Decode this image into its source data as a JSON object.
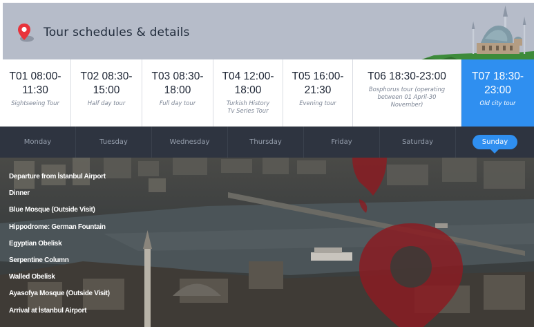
{
  "header": {
    "title": "Tour schedules & details",
    "icon": "map-pin-icon"
  },
  "tours": [
    {
      "code_line1": "T01 08:00-",
      "code_line2": "11:30",
      "description": "Sightseeing Tour",
      "active": false
    },
    {
      "code_line1": "T02 08:30-",
      "code_line2": "15:00",
      "description": "Half day tour",
      "active": false
    },
    {
      "code_line1": "T03 08:30-",
      "code_line2": "18:00",
      "description": "Full day tour",
      "active": false
    },
    {
      "code_line1": "T04 12:00-",
      "code_line2": "18:00",
      "description": "Turkish History Tv Series Tour",
      "active": false
    },
    {
      "code_line1": "T05 16:00-",
      "code_line2": "21:30",
      "description": "Evening tour",
      "active": false
    },
    {
      "code_line1": "T06 18:30-23:00",
      "code_line2": "",
      "description": "Bosphorus tour (operating between 01 April-30 November)",
      "active": false
    },
    {
      "code_line1": "T07 18:30-",
      "code_line2": "23:00",
      "description": "Old city tour",
      "active": true
    }
  ],
  "days": [
    "Monday",
    "Tuesday",
    "Wednesday",
    "Thursday",
    "Friday",
    "Saturday",
    "Sunday"
  ],
  "selected_day": "Sunday",
  "itinerary": [
    "Departure from İstanbul Airport",
    "Dinner",
    "Blue Mosque (Outside Visit)",
    "Hippodrome: German Fountain",
    "Egyptian Obelisk",
    "Serpentine Column",
    "Walled Obelisk",
    "Ayasofya Mosque (Outside Visit)",
    "Arrival at İstanbul Airport"
  ],
  "colors": {
    "accent": "#2f8ff0",
    "header_bg": "#b6bcc9",
    "days_bg": "#2e3440",
    "pin_red": "#e8333b"
  }
}
